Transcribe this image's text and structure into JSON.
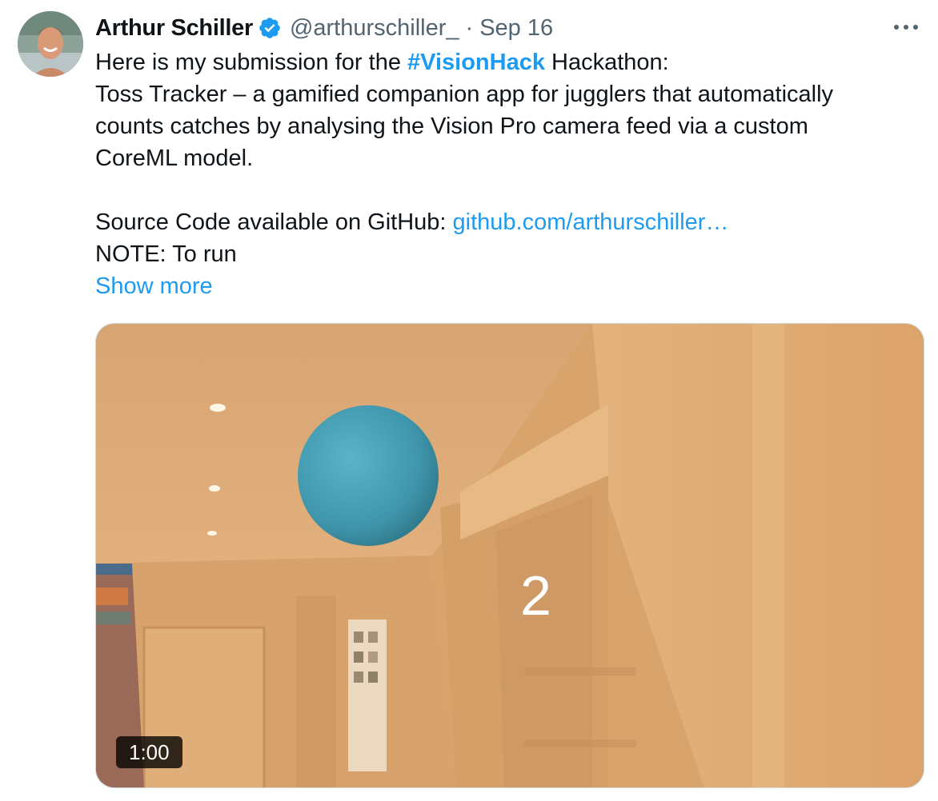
{
  "author": {
    "name": "Arthur Schiller",
    "handle": "@arthurschiller_",
    "separator": "·",
    "date": "Sep 16",
    "avatar_icon": "profile-photo",
    "verified_icon": "verified-badge-icon"
  },
  "menu": {
    "icon": "more-horizontal-icon"
  },
  "body": {
    "line1_prefix": "Here is my submission for the ",
    "hashtag": "#VisionHack",
    "line1_suffix": " Hackathon:",
    "line2": "Toss Tracker – a gamified companion app for jugglers that automatically",
    "line3": "counts catches by analysing the Vision Pro camera feed via a custom",
    "line4": "CoreML model.",
    "source_prefix": "Source Code available on GitHub: ",
    "source_link": "github.com/arthurschiller…",
    "note": "NOTE: To run",
    "show_more": "Show more"
  },
  "media": {
    "counter": "2",
    "duration": "1:00"
  },
  "colors": {
    "accent": "#1d9bf0",
    "text": "#0f1419",
    "secondary": "#536471",
    "video_wall": "#d9a46c",
    "ball": "#3f95ab"
  }
}
